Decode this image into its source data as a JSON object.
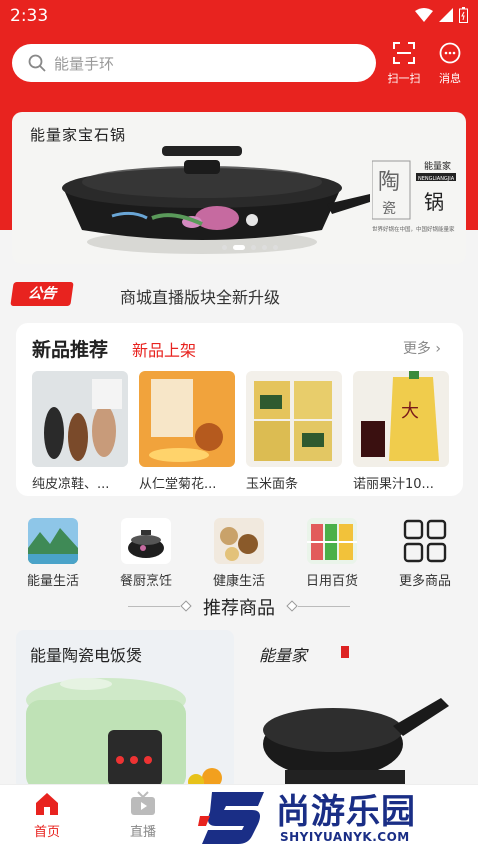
{
  "status": {
    "time": "2:33"
  },
  "header": {
    "search_placeholder": "能量手环",
    "scan_label": "扫一扫",
    "message_label": "消息"
  },
  "banner": {
    "title": "能量家宝石锅",
    "brand_char1": "陶",
    "brand_char2": "瓷",
    "brand_name": "能量家",
    "brand_sub": "NENGLIANGJIA",
    "brand_big": "锅",
    "brand_note": "世界好锅在中国，中国好锅能量家"
  },
  "notice": {
    "tag": "公告",
    "text": "商城直播版块全新升级"
  },
  "new_products": {
    "title": "新品推荐",
    "subtitle": "新品上架",
    "more": "更多",
    "items": [
      {
        "name": "纯皮凉鞋、..."
      },
      {
        "name": "从仁堂菊花..."
      },
      {
        "name": "玉米面条"
      },
      {
        "name": "诺丽果汁10..."
      }
    ]
  },
  "categories": [
    {
      "label": "能量生活"
    },
    {
      "label": "餐厨烹饪"
    },
    {
      "label": "健康生活"
    },
    {
      "label": "日用百货"
    },
    {
      "label": "更多商品"
    }
  ],
  "recommend": {
    "title": "推荐商品",
    "cards": [
      {
        "title": "能量陶瓷电饭煲"
      },
      {
        "title": "能量家"
      }
    ]
  },
  "tabbar": {
    "home": "首页",
    "live": "直播"
  },
  "watermark": {
    "text": "尚游乐园",
    "url": "SHYIYUANYK.COM"
  },
  "colors": {
    "brand_red": "#e8231f",
    "watermark_blue": "#1a2e86"
  }
}
